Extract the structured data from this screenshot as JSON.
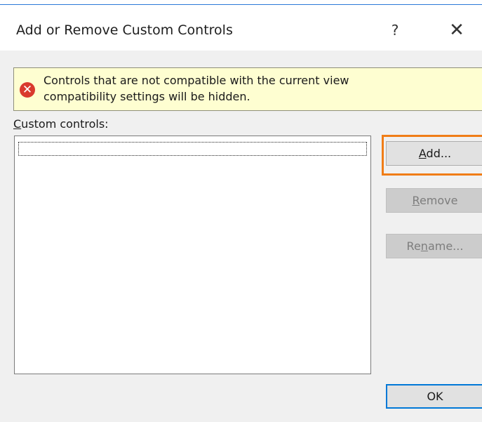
{
  "dialog": {
    "title": "Add or Remove Custom Controls",
    "help_label": "?",
    "close_label": "✕"
  },
  "infobar": {
    "icon": "error-icon",
    "icon_glyph": "✕",
    "line1": "Controls that are not compatible with the current view",
    "line2": "compatibility settings will be hidden."
  },
  "custom_controls": {
    "label_accel": "C",
    "label_rest": "ustom controls:",
    "items": []
  },
  "buttons": {
    "add_accel": "A",
    "add_rest": "dd...",
    "remove_accel": "R",
    "remove_rest": "emove",
    "rename_pre": "Re",
    "rename_accel": "n",
    "rename_rest": "ame...",
    "ok": "OK"
  },
  "colors": {
    "highlight": "#f07d17",
    "infobar_bg": "#fefed1",
    "error": "#d93a2e",
    "default_button_border": "#0078d7"
  }
}
